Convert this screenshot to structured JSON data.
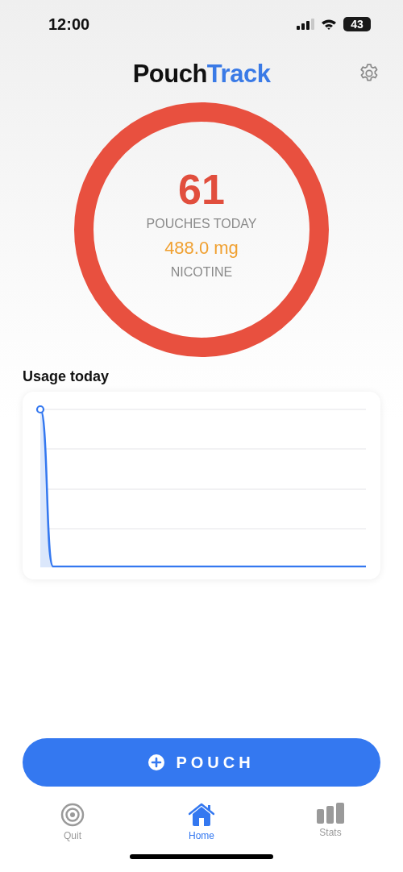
{
  "status_bar": {
    "time": "12:00",
    "battery": "43"
  },
  "header": {
    "title_parts": [
      {
        "text": "Pouch",
        "kind": "plain"
      },
      {
        "text": "Track",
        "kind": "accent"
      }
    ]
  },
  "summary": {
    "count": "61",
    "count_label": "POUCHES TODAY",
    "amount": "488.0 mg",
    "amount_label": "NICOTINE"
  },
  "usage": {
    "title": "Usage today"
  },
  "action_button": {
    "label": "POUCH"
  },
  "tabs": [
    {
      "label": "Quit",
      "kind": "target",
      "selected": false
    },
    {
      "label": "Home",
      "kind": "home",
      "selected": true
    },
    {
      "label": "Stats",
      "kind": "stats",
      "selected": false
    }
  ]
}
